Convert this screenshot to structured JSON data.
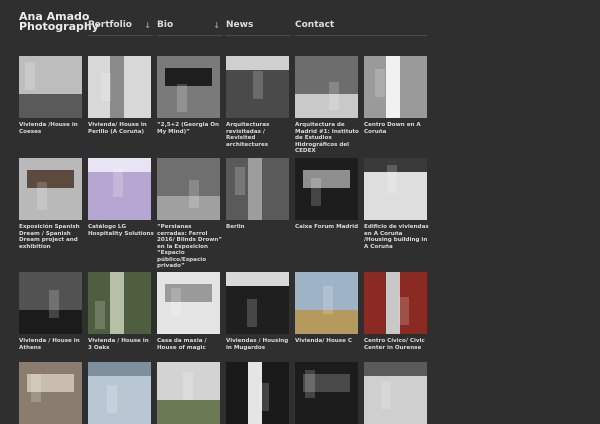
{
  "site": {
    "title_line1": "Ana Amado",
    "title_line2": "Photography"
  },
  "nav": [
    {
      "label": "Portfolio",
      "has_dropdown": true
    },
    {
      "label": "Bio",
      "has_dropdown": true
    },
    {
      "label": "News",
      "has_dropdown": false
    },
    {
      "label": "Contact",
      "has_dropdown": false
    }
  ],
  "dropdown_glyph": "↓",
  "gallery": [
    {
      "caption": "Vivienda /House in Coeses",
      "bg": "#bdbdbd",
      "accent": "#5a5a5a"
    },
    {
      "caption": "Vivienda/ House in Perillo (A Coruña)",
      "bg": "#d8d8d8",
      "accent": "#8a8a8a"
    },
    {
      "caption": "“2,5+2 (Georgia On My Mind)”",
      "bg": "#7a7a7a",
      "accent": "#1e1e1e"
    },
    {
      "caption": "Arquitecturas revisitadas / Revisited architectures",
      "bg": "#4a4a4a",
      "accent": "#cfcfcf"
    },
    {
      "caption": "Arquitectura de Madrid #1: Instituto de Estudios Hidrográficos del CEDEX",
      "bg": "#6d6d6d",
      "accent": "#c9c9c9"
    },
    {
      "caption": "Centro Down en A Coruña",
      "bg": "#9a9a9a",
      "accent": "#f1f1f1"
    },
    {
      "caption": "Exposición Spanish Dream / Spanish Dream project and exhibition",
      "bg": "#b9b9b9",
      "accent": "#5c4a3e"
    },
    {
      "caption": "Catálogo LG Hospitality Solutions",
      "bg": "#b7a6d1",
      "accent": "#e9e4f4"
    },
    {
      "caption": "“Persianas cerradas: Ferrol 2016/ Blinds Drown” en la Exposicion “Espacio público/Espacio privado”",
      "bg": "#6f6f6f",
      "accent": "#a0a0a0"
    },
    {
      "caption": "Berlin",
      "bg": "#5a5a5a",
      "accent": "#9d9d9d"
    },
    {
      "caption": "Caixa Forum Madrid",
      "bg": "#1d1d1d",
      "accent": "#8f8f8f"
    },
    {
      "caption": "Edificio de viviendas en A Coruña /Housing building in A Coruña",
      "bg": "#dedede",
      "accent": "#3a3a3a"
    },
    {
      "caption": "Vivienda / House in Athens",
      "bg": "#525252",
      "accent": "#1b1b1b"
    },
    {
      "caption": "Vivienda / House in 3 Oaks",
      "bg": "#4f5e3e",
      "accent": "#b7c0a6"
    },
    {
      "caption": "Casa da maxia / House of magic",
      "bg": "#e4e4e4",
      "accent": "#9a9a9a"
    },
    {
      "caption": "Viviendas / Housing in Mugardos",
      "bg": "#1f1f1f",
      "accent": "#d9d9d9"
    },
    {
      "caption": "Vivienda/ House C",
      "bg": "#9fb3c7",
      "accent": "#b59a5e"
    },
    {
      "caption": "Centro Cívico/ Civic Center in Ourense",
      "bg": "#8a2a22",
      "accent": "#c8c8c8"
    },
    {
      "caption": "",
      "bg": "#8a7d70",
      "accent": "#c9bdaf"
    },
    {
      "caption": "",
      "bg": "#b9c7d4",
      "accent": "#7e8f9d"
    },
    {
      "caption": "",
      "bg": "#d3d3d3",
      "accent": "#6b7a53"
    },
    {
      "caption": "",
      "bg": "#1a1a1a",
      "accent": "#e5e5e5"
    },
    {
      "caption": "",
      "bg": "#1c1c1c",
      "accent": "#4a4a4a"
    },
    {
      "caption": "",
      "bg": "#cfcfcf",
      "accent": "#5a5a5a"
    }
  ]
}
